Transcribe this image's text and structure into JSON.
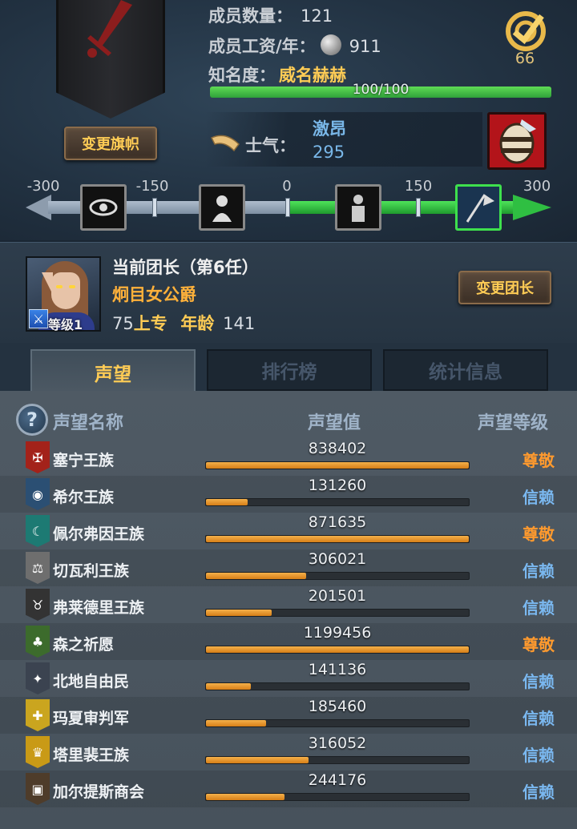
{
  "header": {
    "members_label": "成员数量：",
    "members_value": "121",
    "wage_label": "成员工资/年：",
    "wage_value": "911",
    "fame_label": "知名度：",
    "fame_value": "威名赫赫",
    "fame_progress_text": "100/100",
    "fame_progress": 1.0,
    "change_flag_label": "变更旗帜",
    "target_count": "66"
  },
  "morale": {
    "label": "士气：",
    "state": "激昂",
    "value": "295",
    "scale_ticks": [
      "-300",
      "-150",
      "0",
      "150",
      "300"
    ],
    "icons": [
      "eye-icon",
      "cowering-figure-icon",
      "statue-figure-icon",
      "banner-charge-icon"
    ],
    "barrel_icon": "barrel-icon"
  },
  "leader": {
    "heading": "当前团长（第6任）",
    "title": "炯目女公爵",
    "level": "等级1",
    "skill_value": "75",
    "skill_label": "上专",
    "age_label": "年龄",
    "age_value": "141",
    "change_leader_label": "变更团长"
  },
  "tabs": [
    {
      "label": "声望",
      "active": true
    },
    {
      "label": "排行榜",
      "active": false
    },
    {
      "label": "统计信息",
      "active": false
    }
  ],
  "reputation": {
    "headers": {
      "name": "声望名称",
      "value": "声望值",
      "level": "声望等级"
    },
    "rows": [
      {
        "name": "塞宁王族",
        "value": "838402",
        "progress": 1.0,
        "level": "尊敬",
        "level_color": "#ff9a2e",
        "icon_color": "#a3221a",
        "icon": "sword-crest-icon"
      },
      {
        "name": "希尔王族",
        "value": "131260",
        "progress": 0.16,
        "level": "信赖",
        "level_color": "#7ab8f0",
        "icon_color": "#2b4f73",
        "icon": "globe-crest-icon"
      },
      {
        "name": "佩尔弗因王族",
        "value": "871635",
        "progress": 1.0,
        "level": "尊敬",
        "level_color": "#ff9a2e",
        "icon_color": "#1d7a73",
        "icon": "moon-crest-icon"
      },
      {
        "name": "切瓦利王族",
        "value": "306021",
        "progress": 0.38,
        "level": "信赖",
        "level_color": "#7ab8f0",
        "icon_color": "#6e6e6e",
        "icon": "scales-crest-icon"
      },
      {
        "name": "弗莱德里王族",
        "value": "201501",
        "progress": 0.25,
        "level": "信赖",
        "level_color": "#7ab8f0",
        "icon_color": "#333333",
        "icon": "bull-crest-icon"
      },
      {
        "name": "森之祈愿",
        "value": "1199456",
        "progress": 1.0,
        "level": "尊敬",
        "level_color": "#ff9a2e",
        "icon_color": "#3c6b2c",
        "icon": "tree-crest-icon"
      },
      {
        "name": "北地自由民",
        "value": "141136",
        "progress": 0.17,
        "level": "信赖",
        "level_color": "#7ab8f0",
        "icon_color": "#3b4350",
        "icon": "wolf-crest-icon"
      },
      {
        "name": "玛夏审判军",
        "value": "185460",
        "progress": 0.23,
        "level": "信赖",
        "level_color": "#7ab8f0",
        "icon_color": "#caa51f",
        "icon": "cross-crest-icon"
      },
      {
        "name": "塔里裴王族",
        "value": "316052",
        "progress": 0.39,
        "level": "信赖",
        "level_color": "#7ab8f0",
        "icon_color": "#c99a16",
        "icon": "crown-crest-icon"
      },
      {
        "name": "加尔提斯商会",
        "value": "244176",
        "progress": 0.3,
        "level": "信赖",
        "level_color": "#7ab8f0",
        "icon_color": "#4e3c2a",
        "icon": "chest-crest-icon"
      }
    ]
  }
}
